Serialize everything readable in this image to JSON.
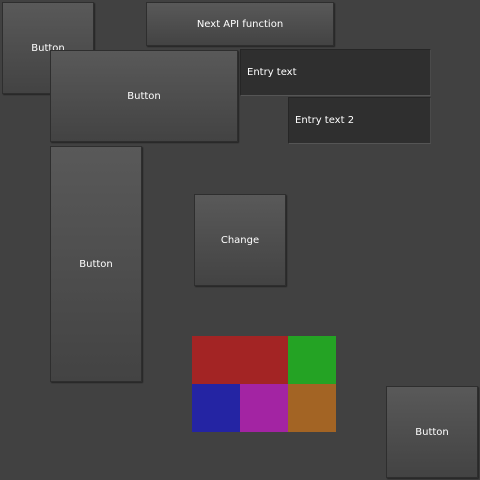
{
  "window": {
    "background": "#414141"
  },
  "buttons": {
    "top_left_label": "Button",
    "next_api_label": "Next API function",
    "wide_label": "Button",
    "tall_label": "Button",
    "change_label": "Change",
    "bottom_right_label": "Button"
  },
  "entries": {
    "entry1_text": "Entry text",
    "entry2_text": "Entry text 2"
  },
  "color_grid": {
    "cells": [
      {
        "name": "red",
        "color": "#a32424"
      },
      {
        "name": "red",
        "color": "#a32424"
      },
      {
        "name": "green",
        "color": "#24a324"
      },
      {
        "name": "blue",
        "color": "#2424a3"
      },
      {
        "name": "magenta",
        "color": "#a324a3"
      },
      {
        "name": "orange",
        "color": "#a36424"
      }
    ]
  }
}
